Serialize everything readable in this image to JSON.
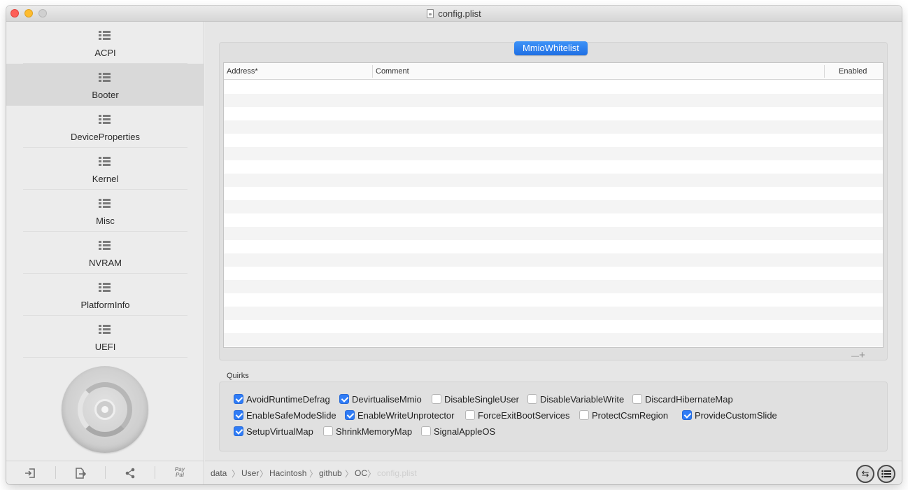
{
  "window": {
    "title": "config.plist",
    "icon": "document-icon"
  },
  "sidebar": {
    "items": [
      {
        "label": "ACPI",
        "icon": "list-icon"
      },
      {
        "label": "Booter",
        "icon": "list-icon",
        "selected": true
      },
      {
        "label": "DeviceProperties",
        "icon": "list-icon"
      },
      {
        "label": "Kernel",
        "icon": "list-icon"
      },
      {
        "label": "Misc",
        "icon": "list-icon"
      },
      {
        "label": "NVRAM",
        "icon": "list-icon"
      },
      {
        "label": "PlatformInfo",
        "icon": "list-icon"
      },
      {
        "label": "UEFI",
        "icon": "list-icon"
      }
    ],
    "toolbar": {
      "import_icon": "import-icon",
      "export_icon": "export-icon",
      "share_icon": "share-icon",
      "paypal_line1": "Pay",
      "paypal_line2": "Pal"
    }
  },
  "main": {
    "tab": "MmioWhitelist",
    "table": {
      "columns": [
        "Address*",
        "Comment",
        "Enabled"
      ],
      "row_count": 20,
      "rows": []
    },
    "table_controls": {
      "remove": "—",
      "add": "+"
    },
    "quirks": {
      "label": "Quirks",
      "items": [
        {
          "label": "AvoidRuntimeDefrag",
          "checked": true
        },
        {
          "label": "DevirtualiseMmio",
          "checked": true
        },
        {
          "label": "DisableSingleUser",
          "checked": false
        },
        {
          "label": "DisableVariableWrite",
          "checked": false
        },
        {
          "label": "DiscardHibernateMap",
          "checked": false
        },
        {
          "label": "EnableSafeModeSlide",
          "checked": true
        },
        {
          "label": "EnableWriteUnprotector",
          "checked": true
        },
        {
          "label": "ForceExitBootServices",
          "checked": false
        },
        {
          "label": "ProtectCsmRegion",
          "checked": false
        },
        {
          "label": "ProvideCustomSlide",
          "checked": true
        },
        {
          "label": "SetupVirtualMap",
          "checked": true
        },
        {
          "label": "ShrinkMemoryMap",
          "checked": false
        },
        {
          "label": "SignalAppleOS",
          "checked": false
        }
      ]
    },
    "path": [
      "data",
      "User",
      "Hacintosh",
      "github",
      "OC",
      "config.plist"
    ],
    "path_separator": "〉",
    "right_buttons": [
      "swap-arrows-icon",
      "list-icon"
    ]
  },
  "colors": {
    "accent": "#2f7cf6",
    "selected_row": "#d9d9d9",
    "background": "#ececec"
  }
}
